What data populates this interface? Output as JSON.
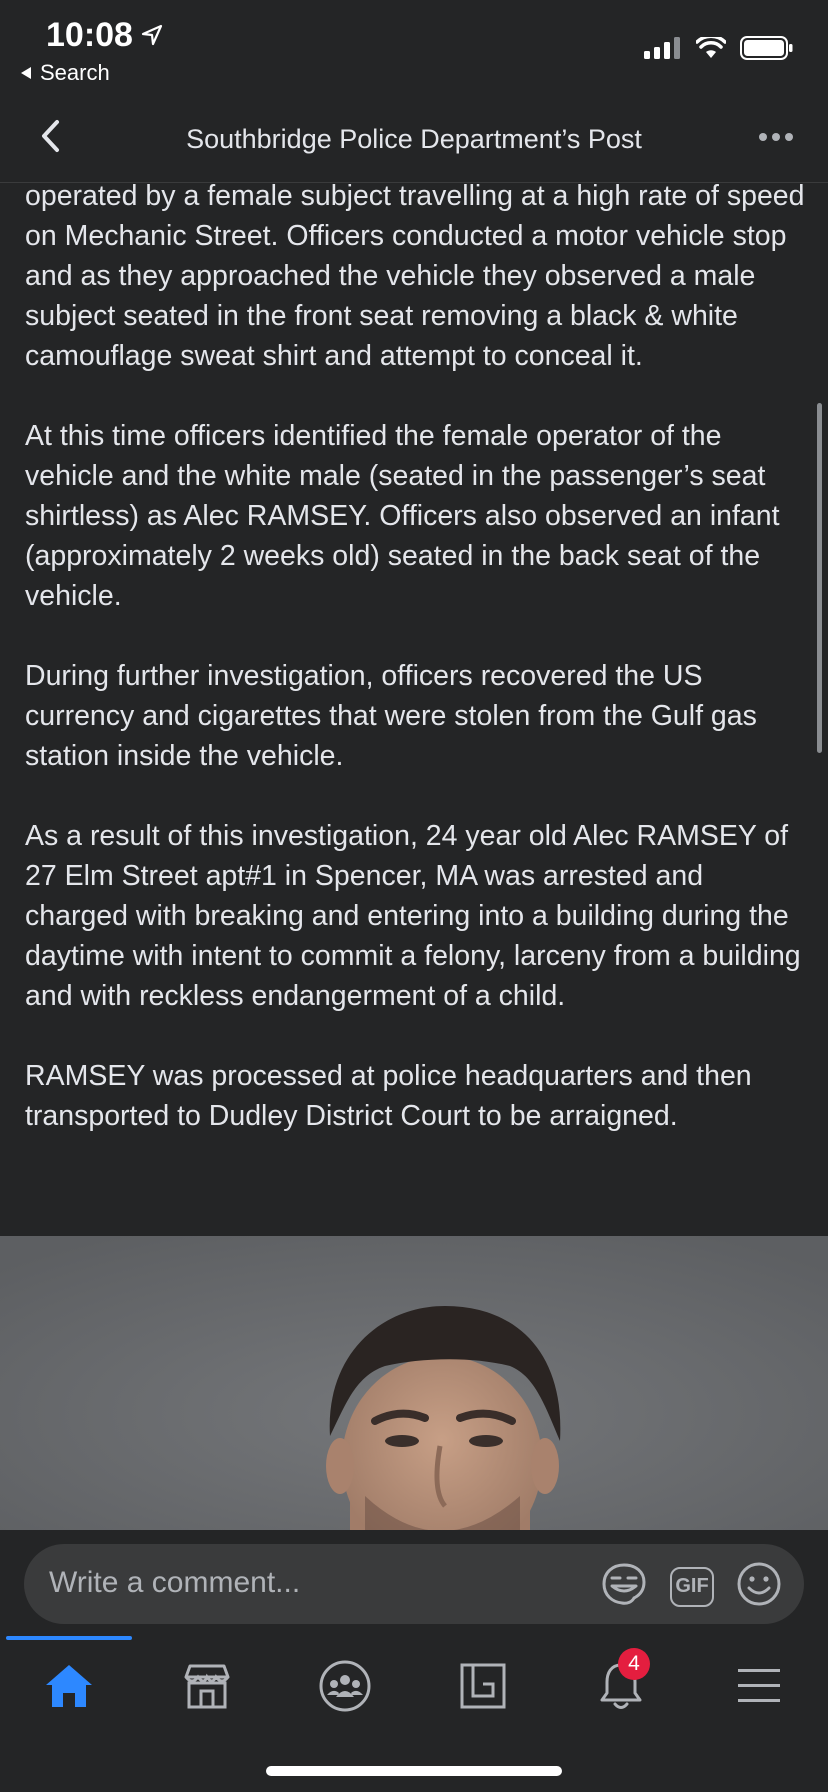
{
  "status_bar": {
    "time": "10:08",
    "back_label": "Search"
  },
  "header": {
    "title": "Southbridge Police Department’s Post"
  },
  "post": {
    "paragraphs": [
      "operated by a female subject travelling at a high rate of speed on Mechanic Street.  Officers conducted a motor vehicle stop and as they approached the vehicle they observed a male subject seated in the front seat removing a black & white camouflage sweat shirt and attempt to conceal it.",
      "At this time officers identified the female operator of the vehicle and the white male (seated in the passenger’s seat shirtless) as Alec RAMSEY.  Officers also observed an infant (approximately 2 weeks old) seated in the back seat of the vehicle.",
      "During further investigation, officers recovered the US currency and cigarettes that were stolen from the Gulf gas station inside the vehicle.",
      "As a result of this investigation, 24 year old Alec RAMSEY of 27 Elm Street apt#1 in Spencer, MA was arrested and charged with breaking and entering into a building during the daytime with intent to commit a felony, larceny from a building and with reckless endangerment of a child.",
      "RAMSEY was processed at police headquarters and then transported to Dudley District Court to be arraigned."
    ]
  },
  "comment": {
    "placeholder": "Write a comment...",
    "gif_label": "GIF"
  },
  "tabs": [
    {
      "icon": "home-icon",
      "active": true
    },
    {
      "icon": "marketplace-icon",
      "active": false
    },
    {
      "icon": "groups-icon",
      "active": false
    },
    {
      "icon": "gaming-icon",
      "active": false
    },
    {
      "icon": "notifications-icon",
      "active": false,
      "badge": "4"
    },
    {
      "icon": "menu-icon",
      "active": false
    }
  ],
  "colors": {
    "background": "#242526",
    "accent": "#2d88ff",
    "badge": "#e41e3f"
  }
}
